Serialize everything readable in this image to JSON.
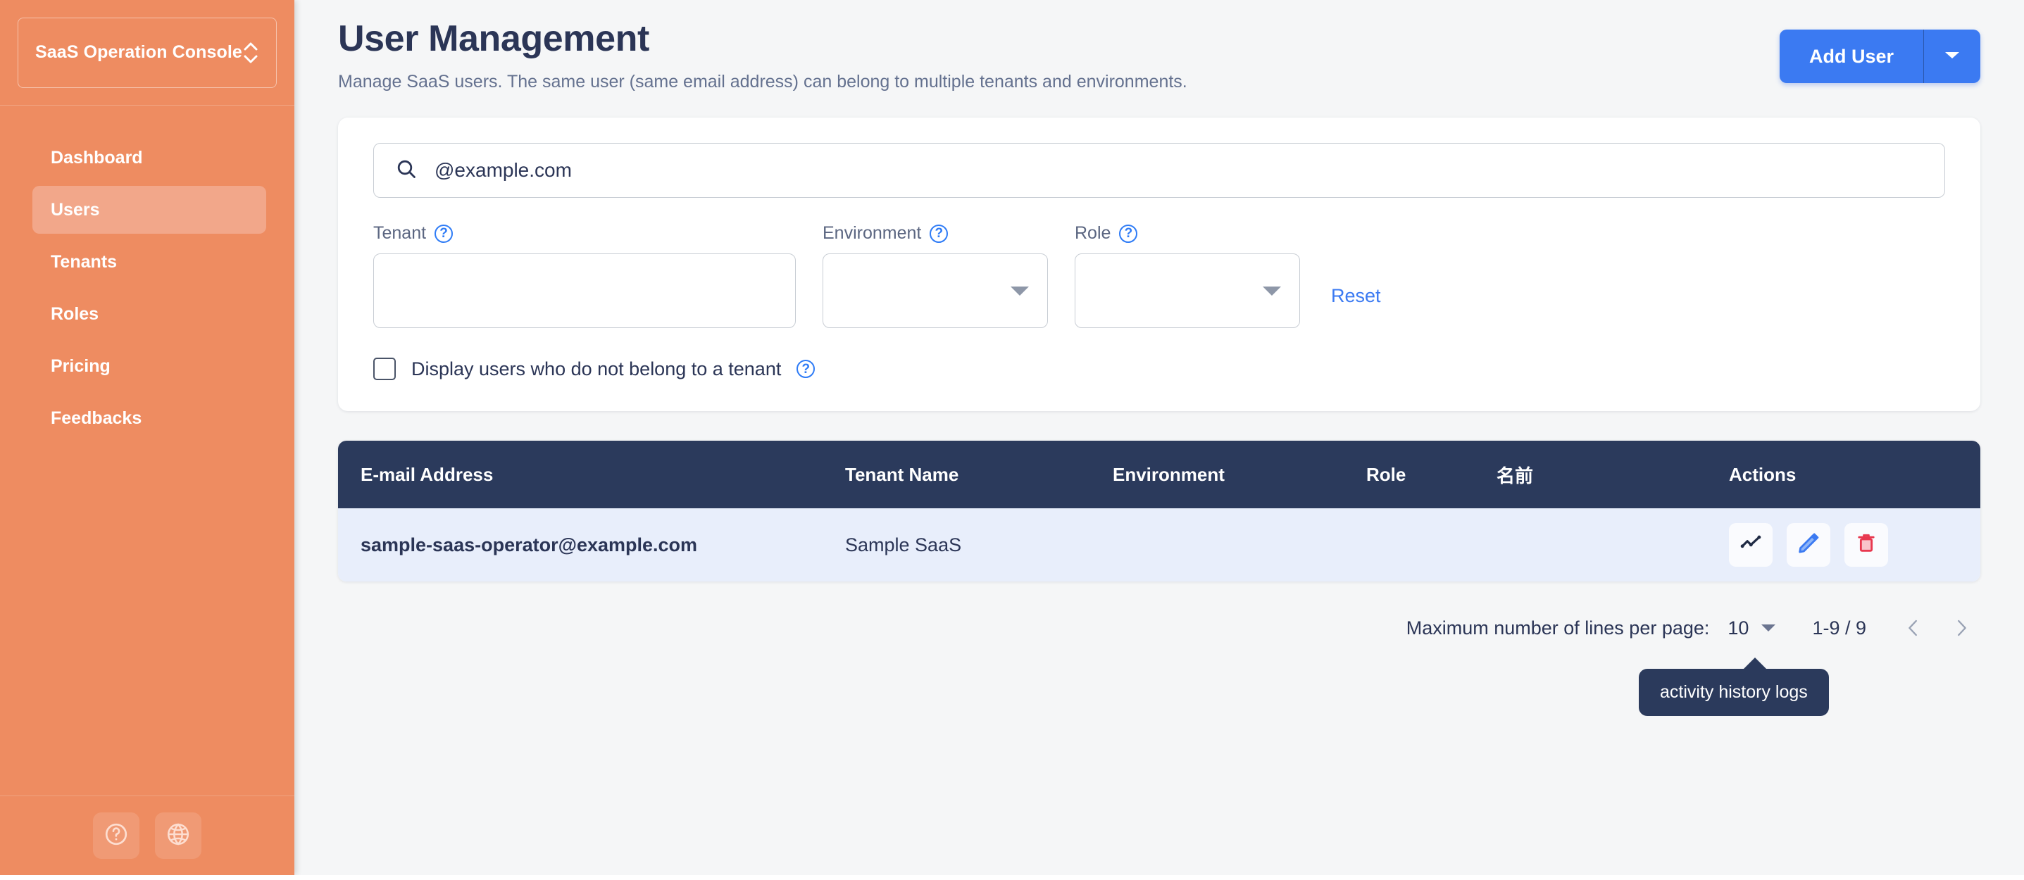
{
  "sidebar": {
    "brand": {
      "label": "SaaS Operation Console",
      "switcher_icon": "up-down-chevrons-icon"
    },
    "items": [
      {
        "label": "Dashboard",
        "active": false
      },
      {
        "label": "Users",
        "active": true
      },
      {
        "label": "Tenants",
        "active": false
      },
      {
        "label": "Roles",
        "active": false
      },
      {
        "label": "Pricing",
        "active": false
      },
      {
        "label": "Feedbacks",
        "active": false
      }
    ],
    "footer": [
      {
        "icon": "help-circle-icon"
      },
      {
        "icon": "globe-icon"
      }
    ]
  },
  "header": {
    "title": "User Management",
    "subtitle": "Manage SaaS users. The same user (same email address) can belong to multiple tenants and environments.",
    "add_user_label": "Add User",
    "add_user_caret_icon": "chevron-down-icon",
    "accent_color": "#3b7af2"
  },
  "filters": {
    "search": {
      "icon": "search-icon",
      "value": "@example.com",
      "placeholder": ""
    },
    "tenant": {
      "label": "Tenant",
      "help_icon": "help-circle-icon",
      "value": ""
    },
    "environment": {
      "label": "Environment",
      "help_icon": "help-circle-icon",
      "value": "",
      "caret_icon": "caret-down-icon"
    },
    "role": {
      "label": "Role",
      "help_icon": "help-circle-icon",
      "value": "",
      "caret_icon": "caret-down-icon"
    },
    "reset_label": "Reset",
    "checkbox": {
      "label": "Display users who do not belong to a tenant",
      "checked": false,
      "help_icon": "help-circle-icon"
    }
  },
  "table": {
    "columns": [
      "E-mail Address",
      "Tenant Name",
      "Environment",
      "Role",
      "名前",
      "Actions"
    ],
    "rows": [
      {
        "email": "sample-saas-operator@example.com",
        "tenant": "Sample SaaS",
        "environment": "",
        "role": "",
        "name": "",
        "actions": [
          {
            "icon": "activity-chart-icon",
            "title": "activity history logs"
          },
          {
            "icon": "pencil-edit-icon",
            "title": "edit"
          },
          {
            "icon": "trash-delete-icon",
            "title": "delete"
          }
        ]
      }
    ],
    "header_bg": "#2b3a5c",
    "row_bg": "#e8eefb"
  },
  "pagination": {
    "rows_per_page_label": "Maximum number of lines per page:",
    "rows_per_page_value": "10",
    "range_label": "1-9 / 9",
    "prev_icon": "chevron-left-icon",
    "next_icon": "chevron-right-icon"
  },
  "tooltip": {
    "text": "activity history logs"
  }
}
